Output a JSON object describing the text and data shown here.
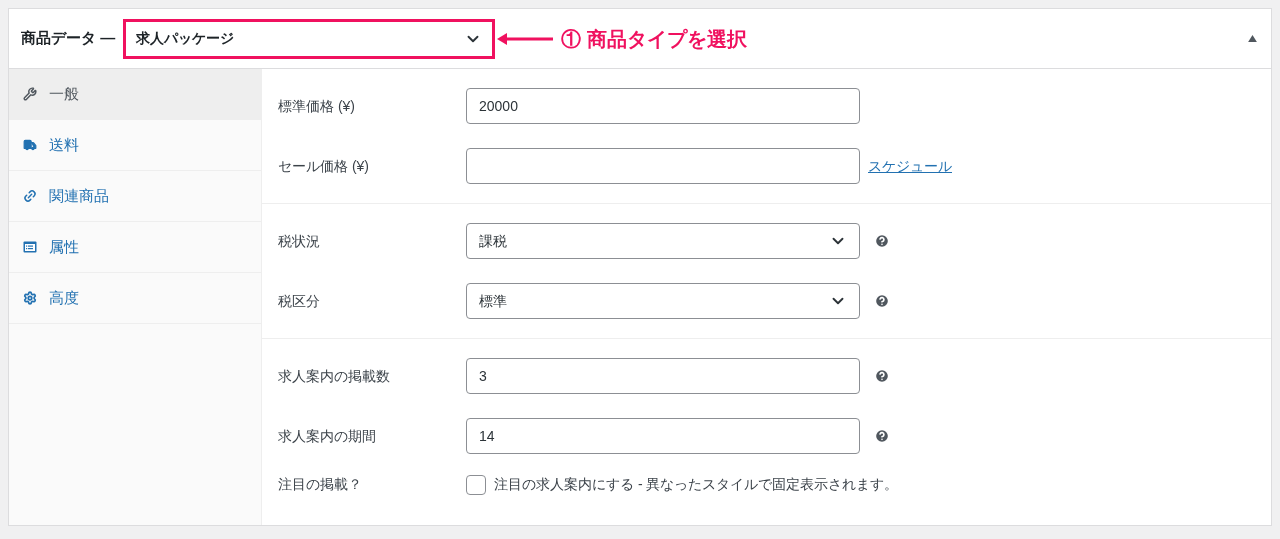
{
  "header": {
    "title": "商品データ —",
    "product_type": "求人パッケージ"
  },
  "annotation": {
    "label": "① 商品タイプを選択"
  },
  "sidebar": {
    "items": [
      {
        "label": "一般",
        "kind": "wrench",
        "selected": true
      },
      {
        "label": "送料",
        "kind": "truck",
        "selected": false
      },
      {
        "label": "関連商品",
        "kind": "link",
        "selected": false
      },
      {
        "label": "属性",
        "kind": "list",
        "selected": false
      },
      {
        "label": "高度",
        "kind": "gear",
        "selected": false
      }
    ]
  },
  "sections": [
    [
      {
        "kind": "text",
        "label": "標準価格 (¥)",
        "value": "20000",
        "help": false
      },
      {
        "kind": "text",
        "label": "セール価格 (¥)",
        "help": false,
        "link": "スケジュール"
      }
    ],
    [
      {
        "kind": "select",
        "label": "税状況",
        "value": "課税",
        "help": true
      },
      {
        "kind": "select",
        "label": "税区分",
        "value": "標準",
        "help": true
      }
    ],
    [
      {
        "kind": "text",
        "label": "求人案内の掲載数",
        "value": "3",
        "help": true
      },
      {
        "kind": "text",
        "label": "求人案内の期間",
        "value": "14",
        "help": true
      },
      {
        "kind": "checkbox",
        "label": "注目の掲載？",
        "value": "注目の求人案内にする - 異なったスタイルで固定表示されます。",
        "checked": false
      }
    ]
  ]
}
